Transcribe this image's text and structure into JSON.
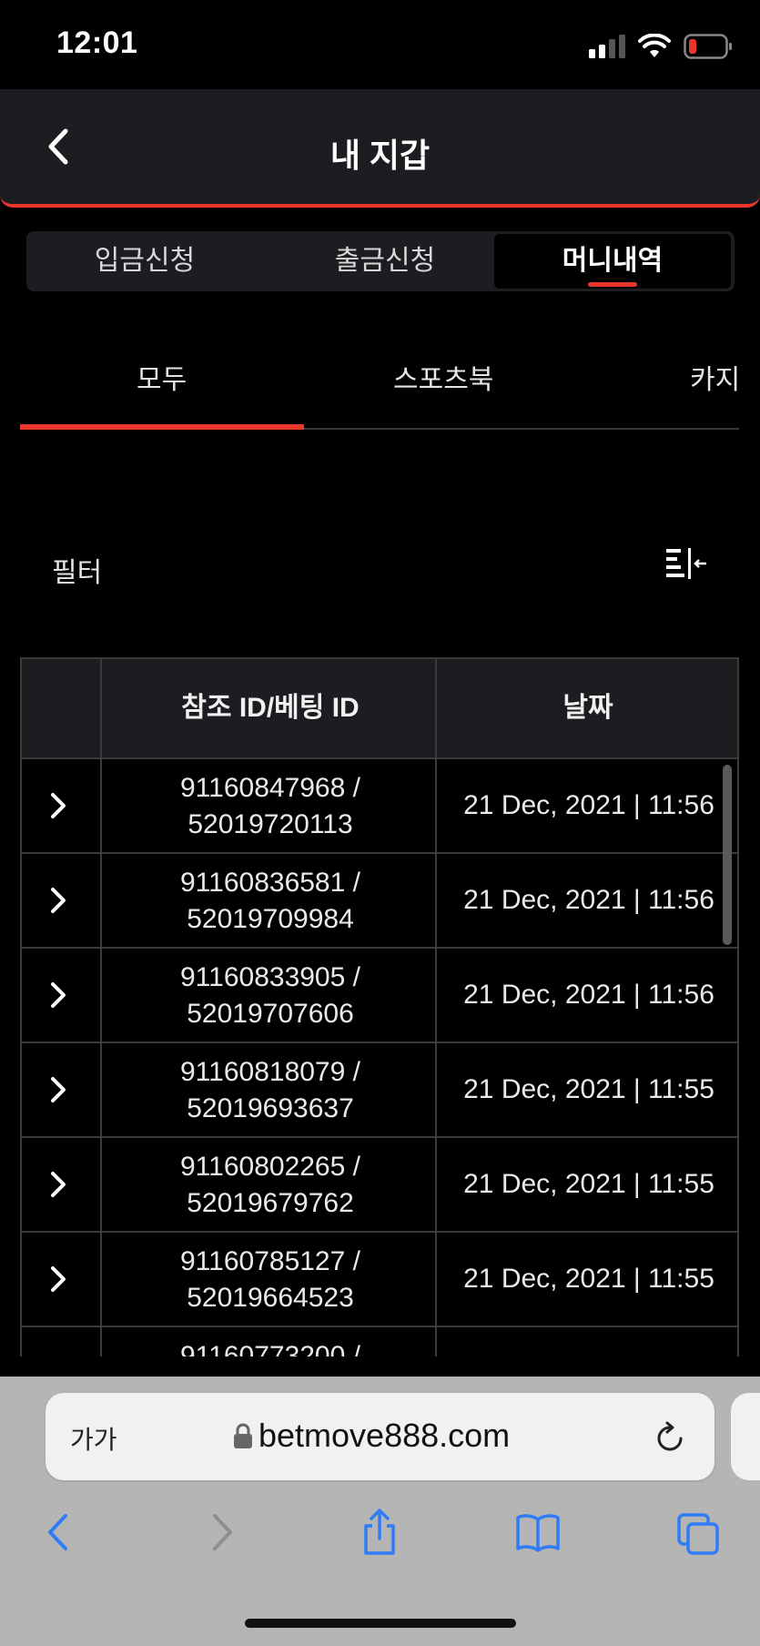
{
  "status_bar": {
    "time": "12:01"
  },
  "header": {
    "title": "내 지갑"
  },
  "segment_tabs": [
    {
      "label": "입금신청",
      "active": false
    },
    {
      "label": "출금신청",
      "active": false
    },
    {
      "label": "머니내역",
      "active": true
    }
  ],
  "sub_tabs": [
    {
      "label": "모두",
      "active": true
    },
    {
      "label": "스포츠북",
      "active": false
    },
    {
      "label": "카지",
      "active": false
    }
  ],
  "filter": {
    "label": "필터",
    "icon": "filter-collapse-icon"
  },
  "table": {
    "headers": [
      "",
      "참조 ID/베팅 ID",
      "날짜"
    ],
    "rows": [
      {
        "ref": "91160847968 /",
        "bet": "52019720113",
        "date": "21 Dec, 2021 | 11:56"
      },
      {
        "ref": "91160836581 /",
        "bet": "52019709984",
        "date": "21 Dec, 2021 | 11:56"
      },
      {
        "ref": "91160833905 /",
        "bet": "52019707606",
        "date": "21 Dec, 2021 | 11:56"
      },
      {
        "ref": "91160818079 /",
        "bet": "52019693637",
        "date": "21 Dec, 2021 | 11:55"
      },
      {
        "ref": "91160802265 /",
        "bet": "52019679762",
        "date": "21 Dec, 2021 | 11:55"
      },
      {
        "ref": "91160785127 /",
        "bet": "52019664523",
        "date": "21 Dec, 2021 | 11:55"
      },
      {
        "ref": "91160773200 /",
        "bet": "",
        "date": ""
      }
    ]
  },
  "browser": {
    "aa_label": "가가",
    "url": "betmove888.com"
  },
  "colors": {
    "accent": "#e8362c",
    "surface": "#1c1d21",
    "ios_blue": "#2f7cf6"
  }
}
